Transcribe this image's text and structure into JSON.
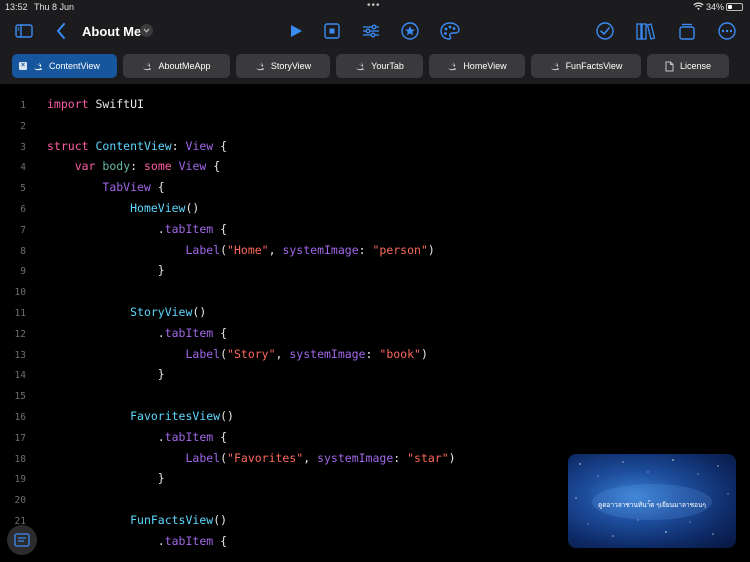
{
  "status": {
    "time": "13:52",
    "date": "Thu 8 Jun",
    "battery": "34%",
    "battery_level": 0.34
  },
  "toolbar": {
    "title": "About Me",
    "icons": [
      "sidebar-icon",
      "back-chevron-icon",
      "play-icon",
      "stop-icon",
      "sliders-icon",
      "star-circle-icon",
      "palette-icon",
      "checkmark-circle-icon",
      "library-icon",
      "windows-icon",
      "more-icon"
    ]
  },
  "tabs": [
    {
      "label": "ContentView",
      "active": true
    },
    {
      "label": "AboutMeApp",
      "active": false
    },
    {
      "label": "StoryView",
      "active": false
    },
    {
      "label": "YourTab",
      "active": false
    },
    {
      "label": "HomeView",
      "active": false
    },
    {
      "label": "FunFactsView",
      "active": false
    },
    {
      "label": "License",
      "active": false,
      "icon": "document-icon"
    }
  ],
  "code": {
    "line_numbers": [
      "1",
      "2",
      "3",
      "4",
      "5",
      "6",
      "7",
      "8",
      "9",
      "10",
      "11",
      "12",
      "13",
      "14",
      "15",
      "16",
      "17",
      "18",
      "19",
      "20",
      "21",
      "22"
    ],
    "colors": {
      "keyword": "#fc5fa3",
      "type": "#5dd8ff",
      "function": "#a167e6",
      "string": "#fc6a5d",
      "plain": "#e8e8e8"
    },
    "lines": [
      [
        [
          "kw",
          "import"
        ],
        [
          "pl",
          " SwiftUI"
        ]
      ],
      [],
      [
        [
          "kw",
          "struct"
        ],
        [
          "pl",
          " "
        ],
        [
          "ty",
          "ContentView"
        ],
        [
          "pl",
          ": "
        ],
        [
          "fn",
          "View"
        ],
        [
          "pl",
          " {"
        ]
      ],
      [
        [
          "pl",
          "    "
        ],
        [
          "kw",
          "var"
        ],
        [
          "pl",
          " "
        ],
        [
          "vr",
          "body"
        ],
        [
          "pl",
          ": "
        ],
        [
          "kw",
          "some"
        ],
        [
          "pl",
          " "
        ],
        [
          "fn",
          "View"
        ],
        [
          "pl",
          " {"
        ]
      ],
      [
        [
          "pl",
          "        "
        ],
        [
          "fn",
          "TabView"
        ],
        [
          "pl",
          " {"
        ]
      ],
      [
        [
          "pl",
          "            "
        ],
        [
          "ty",
          "HomeView"
        ],
        [
          "pl",
          "()"
        ]
      ],
      [
        [
          "pl",
          "                ."
        ],
        [
          "fn",
          "tabItem"
        ],
        [
          "pl",
          " {"
        ]
      ],
      [
        [
          "pl",
          "                    "
        ],
        [
          "fn",
          "Label"
        ],
        [
          "pl",
          "("
        ],
        [
          "str",
          "\"Home\""
        ],
        [
          "pl",
          ", "
        ],
        [
          "fn",
          "systemImage"
        ],
        [
          "pl",
          ": "
        ],
        [
          "str",
          "\"person\""
        ],
        [
          "pl",
          ")"
        ]
      ],
      [
        [
          "pl",
          "                }"
        ]
      ],
      [],
      [
        [
          "pl",
          "            "
        ],
        [
          "ty",
          "StoryView"
        ],
        [
          "pl",
          "()"
        ]
      ],
      [
        [
          "pl",
          "                ."
        ],
        [
          "fn",
          "tabItem"
        ],
        [
          "pl",
          " {"
        ]
      ],
      [
        [
          "pl",
          "                    "
        ],
        [
          "fn",
          "Label"
        ],
        [
          "pl",
          "("
        ],
        [
          "str",
          "\"Story\""
        ],
        [
          "pl",
          ", "
        ],
        [
          "fn",
          "systemImage"
        ],
        [
          "pl",
          ": "
        ],
        [
          "str",
          "\"book\""
        ],
        [
          "pl",
          ")"
        ]
      ],
      [
        [
          "pl",
          "                }"
        ]
      ],
      [],
      [
        [
          "pl",
          "            "
        ],
        [
          "ty",
          "FavoritesView"
        ],
        [
          "pl",
          "()"
        ]
      ],
      [
        [
          "pl",
          "                ."
        ],
        [
          "fn",
          "tabItem"
        ],
        [
          "pl",
          " {"
        ]
      ],
      [
        [
          "pl",
          "                    "
        ],
        [
          "fn",
          "Label"
        ],
        [
          "pl",
          "("
        ],
        [
          "str",
          "\"Favorites\""
        ],
        [
          "pl",
          ", "
        ],
        [
          "fn",
          "systemImage"
        ],
        [
          "pl",
          ": "
        ],
        [
          "str",
          "\"star\""
        ],
        [
          "pl",
          ")"
        ]
      ],
      [
        [
          "pl",
          "                }"
        ]
      ],
      [],
      [
        [
          "pl",
          "            "
        ],
        [
          "ty",
          "FunFactsView"
        ],
        [
          "pl",
          "()"
        ]
      ],
      [
        [
          "pl",
          "                ."
        ],
        [
          "fn",
          "tabItem"
        ],
        [
          "pl",
          " {"
        ]
      ]
    ]
  },
  "pip": {
    "caption": "ดูดอาวลาชานท้นา้ต ๆเยียนมาลาชอนๆ"
  }
}
